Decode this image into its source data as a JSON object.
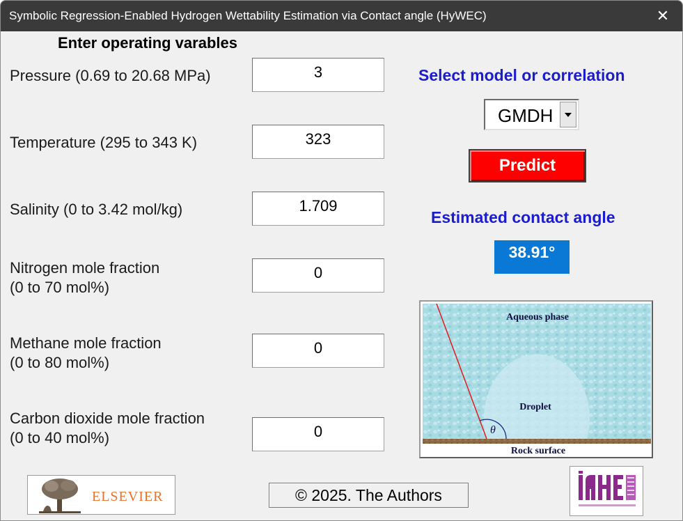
{
  "window": {
    "title": "Symbolic Regression-Enabled Hydrogen Wettability Estimation via Contact angle  (HyWEC)",
    "close_glyph": "✕"
  },
  "inputs": {
    "header": "Enter operating varables",
    "pressure": {
      "label": "Pressure (0.69 to 20.68 MPa)",
      "value": "3"
    },
    "temperature": {
      "label": "Temperature (295 to 343 K)",
      "value": "323"
    },
    "salinity": {
      "label": "Salinity (0 to 3.42 mol/kg)",
      "value": "1.709"
    },
    "nitrogen": {
      "label_line1": "Nitrogen mole fraction",
      "label_line2": "(0 to 70 mol%)",
      "value": "0"
    },
    "methane": {
      "label_line1": "Methane mole fraction",
      "label_line2": "(0 to 80 mol%)",
      "value": "0"
    },
    "co2": {
      "label_line1": "Carbon dioxide mole fraction",
      "label_line2": "(0 to 40 mol%)",
      "value": "0"
    }
  },
  "model": {
    "heading": "Select model or correlation",
    "selected": "GMDH",
    "predict_label": "Predict"
  },
  "result": {
    "heading": "Estimated contact angle",
    "value": "38.91°"
  },
  "diagram": {
    "aqueous_label": "Aqueous phase",
    "droplet_label": "Droplet",
    "theta_label": "θ",
    "rock_label": "Rock surface"
  },
  "footer": {
    "publisher": "ELSEVIER",
    "copyright": "© 2025. The Authors",
    "right_logo_text": "iahe"
  },
  "colors": {
    "heading_blue": "#1c1ccf",
    "predict_red": "#ff0000",
    "result_blue": "#0a79d6",
    "water": "#a8dbe4",
    "rock": "#8b6a45",
    "elsevier_orange": "#e8722a",
    "iahe_purple": "#8a2a8a"
  }
}
